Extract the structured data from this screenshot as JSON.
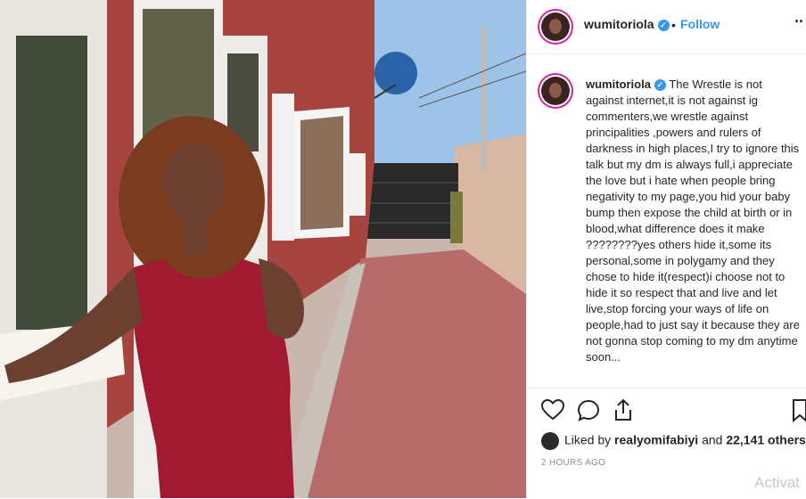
{
  "post": {
    "username": "wumitoriola",
    "follow_label": "Follow",
    "dot": "•",
    "more_label": "··",
    "caption": "The Wrestle is not against internet,it is not against ig commenters,we wrestle against principalities ,powers and rulers of darkness in high places,I try to ignore this talk but my dm is always full,i appreciate the love but i hate when people bring negativity to my page,you hid your baby bump then expose the child at birth or in blood,what difference does it make ????????yes others hide it,some its personal,some in polygamy and they chose to hide it(respect)i choose not to hide it so respect that and live and let live,stop forcing your ways of life on people,had to just say it because they are not gonna stop coming to my dm anytime soon...",
    "likes_prefix": "Liked by",
    "liked_by_user": "realyomifabiyi",
    "likes_suffix": "and",
    "likes_count": "22,141 others",
    "timestamp": "2 HOURS AGO"
  },
  "icons": {
    "verified": "verified-badge-icon",
    "like": "heart-icon",
    "comment": "comment-bubble-icon",
    "share": "share-icon",
    "save": "bookmark-icon"
  },
  "watermark": "Activat",
  "colors": {
    "link": "#3897f0",
    "dress": "#a11a32",
    "story_ring": "#d6249f"
  }
}
